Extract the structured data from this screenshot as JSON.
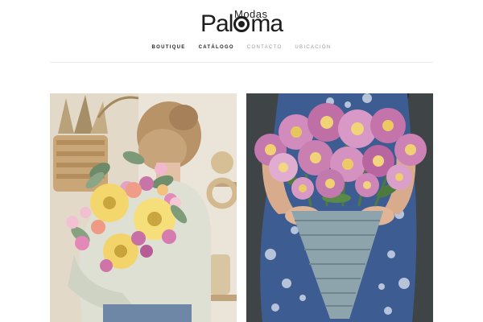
{
  "brand": {
    "name_top": "Modas",
    "name_main_a": "Pal",
    "name_main_b": "ma"
  },
  "nav": {
    "items": [
      {
        "label": "BOUTIQUE",
        "active": true
      },
      {
        "label": "CATÁLOGO",
        "active": true
      },
      {
        "label": "CONTACTO",
        "active": false
      },
      {
        "label": "UBICACIÓN",
        "active": false
      }
    ]
  },
  "gallery": [
    {
      "name": "woman-gerbera-bouquet-photo"
    },
    {
      "name": "woman-dahlia-basket-photo"
    }
  ],
  "colors": {
    "text": "#1d1d1d",
    "nav_muted": "#9a9a9a",
    "divider": "#e9e9e9"
  }
}
